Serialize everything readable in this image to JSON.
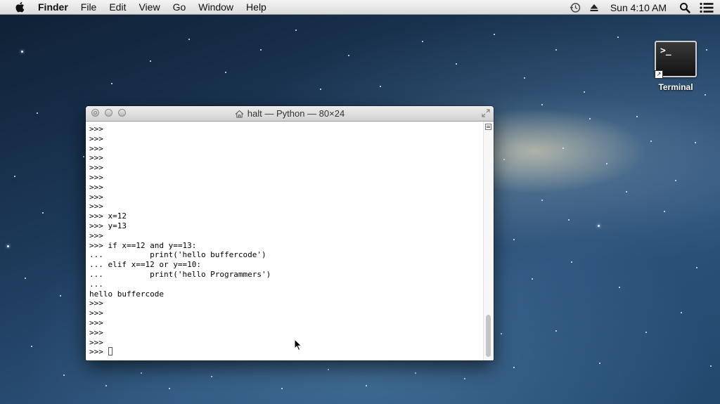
{
  "menubar": {
    "app_name": "Finder",
    "items": [
      "File",
      "Edit",
      "View",
      "Go",
      "Window",
      "Help"
    ],
    "clock": "Sun 4:10 AM",
    "icons": [
      "apple-icon",
      "time-machine-icon",
      "eject-icon",
      "spotlight-search-icon",
      "notification-center-icon"
    ]
  },
  "desktop": {
    "icons": [
      {
        "label": "Terminal",
        "glyph": ">_"
      }
    ]
  },
  "terminal": {
    "title": "halt — Python — 80×24",
    "lines": [
      ">>>",
      ">>>",
      ">>>",
      ">>>",
      ">>>",
      ">>>",
      ">>>",
      ">>>",
      ">>>",
      ">>> x=12",
      ">>> y=13",
      ">>>",
      ">>> if x==12 and y==13:",
      "...          print('hello buffercode')",
      "... elif x==12 or y==10:",
      "...          print('hello Programmers')",
      "...",
      "hello buffercode",
      ">>>",
      ">>>",
      ">>>",
      ">>>",
      ">>>"
    ],
    "prompt": ">>> "
  }
}
